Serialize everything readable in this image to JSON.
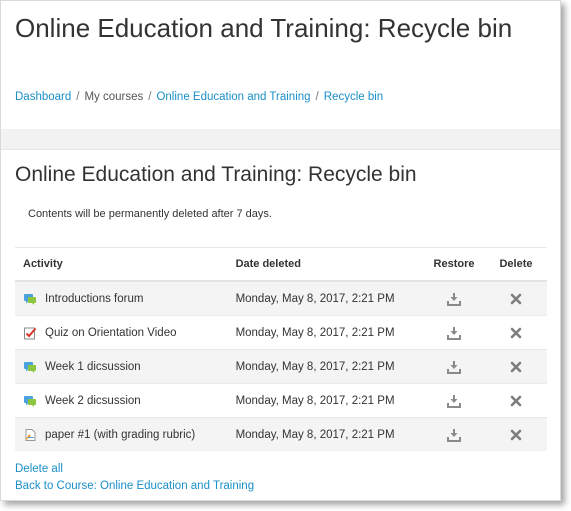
{
  "page": {
    "title": "Online Education and Training: Recycle bin"
  },
  "breadcrumb": [
    {
      "label": "Dashboard",
      "link": true
    },
    {
      "label": "My courses",
      "link": false
    },
    {
      "label": "Online Education and Training",
      "link": true
    },
    {
      "label": "Recycle bin",
      "link": true
    }
  ],
  "main": {
    "heading": "Online Education and Training: Recycle bin",
    "notice": "Contents will be permanently deleted after 7 days.",
    "columns": {
      "activity": "Activity",
      "date": "Date deleted",
      "restore": "Restore",
      "delete": "Delete"
    },
    "rows": [
      {
        "name": "Introductions forum",
        "date": "Monday, May 8, 2017, 2:21 PM",
        "icon": "forum-icon"
      },
      {
        "name": "Quiz on Orientation Video",
        "date": "Monday, May 8, 2017, 2:21 PM",
        "icon": "quiz-icon"
      },
      {
        "name": "Week 1 dicsussion",
        "date": "Monday, May 8, 2017, 2:21 PM",
        "icon": "forum-icon"
      },
      {
        "name": "Week 2 dicsussion",
        "date": "Monday, May 8, 2017, 2:21 PM",
        "icon": "forum-icon"
      },
      {
        "name": "paper #1 (with grading rubric)",
        "date": "Monday, May 8, 2017, 2:21 PM",
        "icon": "assignment-icon"
      }
    ],
    "delete_all": "Delete all",
    "back_link": "Back to Course: Online Education and Training"
  },
  "colors": {
    "link": "#1a8fc9",
    "text": "#333333",
    "stripe": "#f4f4f4",
    "band": "#f2f2f2"
  }
}
